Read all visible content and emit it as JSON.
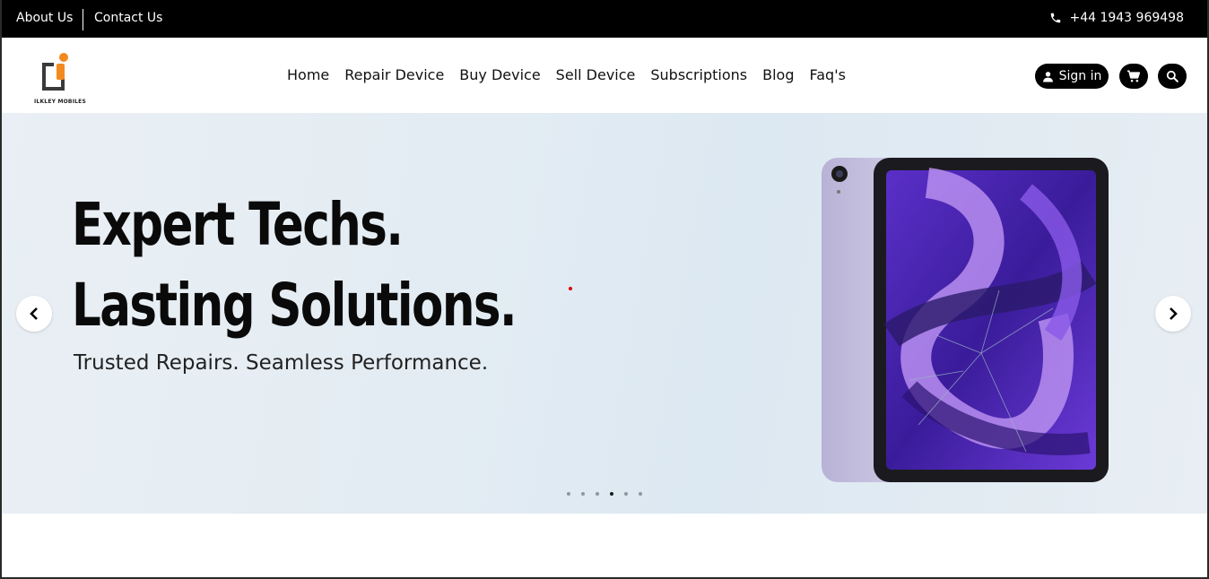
{
  "topbar": {
    "about_label": "About Us",
    "contact_label": "Contact Us",
    "phone": "+44 1943 969498"
  },
  "brand": {
    "name": "ILKLEY MOBILES",
    "accent": "#f28a1e"
  },
  "nav": {
    "items": [
      "Home",
      "Repair Device",
      "Buy Device",
      "Sell Device",
      "Subscriptions",
      "Blog",
      "Faq's"
    ],
    "signin_label": "Sign in"
  },
  "hero": {
    "headline_1": "Expert Techs.",
    "headline_2": "Lasting Solutions.",
    "subline": "Trusted Repairs. Seamless Performance.",
    "slide_count": 6,
    "active_slide": 4
  },
  "icons": [
    "phone-icon",
    "user-icon",
    "cart-icon",
    "search-icon",
    "chevron-left-icon",
    "chevron-right-icon"
  ]
}
